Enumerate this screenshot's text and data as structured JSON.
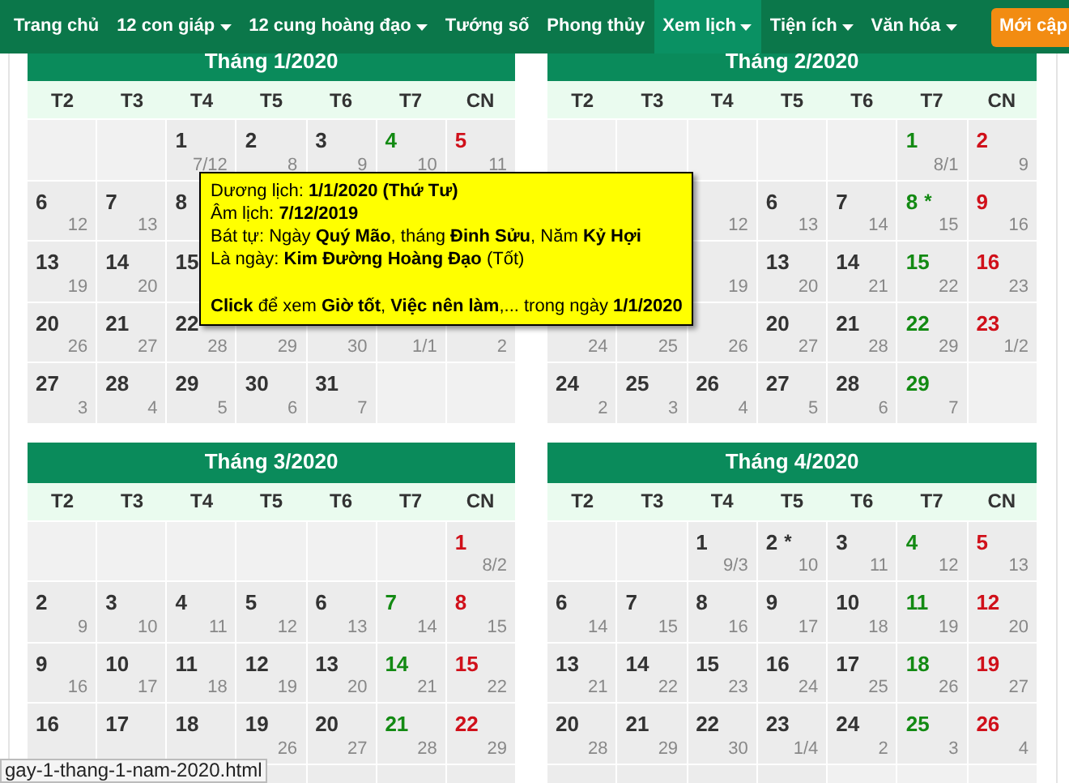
{
  "nav": {
    "items": [
      {
        "label": "Trang chủ",
        "dropdown": false,
        "selected": false
      },
      {
        "label": "12 con giáp",
        "dropdown": true,
        "selected": false
      },
      {
        "label": "12 cung hoàng đạo",
        "dropdown": true,
        "selected": false
      },
      {
        "label": "Tướng số",
        "dropdown": false,
        "selected": false
      },
      {
        "label": "Phong thủy",
        "dropdown": false,
        "selected": false
      },
      {
        "label": "Xem lịch",
        "dropdown": true,
        "selected": true
      },
      {
        "label": "Tiện ích",
        "dropdown": true,
        "selected": false
      },
      {
        "label": "Văn hóa",
        "dropdown": true,
        "selected": false
      }
    ],
    "button": "Mới cập"
  },
  "months": [
    {
      "title": "Tháng 1/2020",
      "weekdays": [
        "T2",
        "T3",
        "T4",
        "T5",
        "T6",
        "T7",
        "CN"
      ],
      "rows": [
        [
          {
            "kind": "empty"
          },
          {
            "kind": "empty"
          },
          {
            "kind": "day",
            "day": "1",
            "lunar": "7/12"
          },
          {
            "kind": "day",
            "day": "2",
            "lunar": "8"
          },
          {
            "kind": "day",
            "day": "3",
            "lunar": "9"
          },
          {
            "kind": "day",
            "day": "4",
            "lunar": "10"
          },
          {
            "kind": "day",
            "day": "5",
            "lunar": "11"
          }
        ],
        [
          {
            "kind": "day",
            "day": "6",
            "lunar": "12"
          },
          {
            "kind": "day",
            "day": "7",
            "lunar": "13"
          },
          {
            "kind": "day",
            "day": "8"
          },
          {
            "kind": "covered"
          },
          {
            "kind": "covered"
          },
          {
            "kind": "covered"
          },
          {
            "kind": "covered"
          }
        ],
        [
          {
            "kind": "day",
            "day": "13",
            "lunar": "19"
          },
          {
            "kind": "day",
            "day": "14",
            "lunar": "20"
          },
          {
            "kind": "day",
            "day": "15"
          },
          {
            "kind": "covered"
          },
          {
            "kind": "covered"
          },
          {
            "kind": "covered"
          },
          {
            "kind": "covered"
          }
        ],
        [
          {
            "kind": "day",
            "day": "20",
            "lunar": "26"
          },
          {
            "kind": "day",
            "day": "21",
            "lunar": "27"
          },
          {
            "kind": "day",
            "day": "22",
            "lunar": "28"
          },
          {
            "kind": "day",
            "lunar": "29"
          },
          {
            "kind": "day",
            "lunar": "30"
          },
          {
            "kind": "day",
            "lunar": "1/1"
          },
          {
            "kind": "day",
            "lunar": "2"
          }
        ],
        [
          {
            "kind": "day",
            "day": "27",
            "lunar": "3"
          },
          {
            "kind": "day",
            "day": "28",
            "lunar": "4"
          },
          {
            "kind": "day",
            "day": "29",
            "lunar": "5"
          },
          {
            "kind": "day",
            "day": "30",
            "lunar": "6"
          },
          {
            "kind": "day",
            "day": "31",
            "lunar": "7"
          },
          {
            "kind": "empty"
          },
          {
            "kind": "empty"
          }
        ]
      ]
    },
    {
      "title": "Tháng 2/2020",
      "weekdays": [
        "T2",
        "T3",
        "T4",
        "T5",
        "T6",
        "T7",
        "CN"
      ],
      "rows": [
        [
          {
            "kind": "empty"
          },
          {
            "kind": "empty"
          },
          {
            "kind": "empty"
          },
          {
            "kind": "empty"
          },
          {
            "kind": "empty"
          },
          {
            "kind": "day",
            "day": "1",
            "lunar": "8/1"
          },
          {
            "kind": "day",
            "day": "2",
            "lunar": "9"
          }
        ],
        [
          {
            "kind": "covered"
          },
          {
            "kind": "covered"
          },
          {
            "kind": "day",
            "lunar": "12"
          },
          {
            "kind": "day",
            "day": "6",
            "lunar": "13"
          },
          {
            "kind": "day",
            "day": "7",
            "lunar": "14"
          },
          {
            "kind": "day",
            "day": "8",
            "mark": "*",
            "lunar": "15"
          },
          {
            "kind": "day",
            "day": "9",
            "lunar": "16"
          }
        ],
        [
          {
            "kind": "covered"
          },
          {
            "kind": "covered"
          },
          {
            "kind": "day",
            "lunar": "19"
          },
          {
            "kind": "day",
            "day": "13",
            "lunar": "20"
          },
          {
            "kind": "day",
            "day": "14",
            "lunar": "21"
          },
          {
            "kind": "day",
            "day": "15",
            "lunar": "22"
          },
          {
            "kind": "day",
            "day": "16",
            "lunar": "23"
          }
        ],
        [
          {
            "kind": "day",
            "lunar": "24"
          },
          {
            "kind": "day",
            "lunar": "25"
          },
          {
            "kind": "day",
            "lunar": "26"
          },
          {
            "kind": "day",
            "day": "20",
            "lunar": "27"
          },
          {
            "kind": "day",
            "day": "21",
            "lunar": "28"
          },
          {
            "kind": "day",
            "day": "22",
            "lunar": "29"
          },
          {
            "kind": "day",
            "day": "23",
            "lunar": "1/2"
          }
        ],
        [
          {
            "kind": "day",
            "day": "24",
            "lunar": "2"
          },
          {
            "kind": "day",
            "day": "25",
            "lunar": "3"
          },
          {
            "kind": "day",
            "day": "26",
            "lunar": "4"
          },
          {
            "kind": "day",
            "day": "27",
            "lunar": "5"
          },
          {
            "kind": "day",
            "day": "28",
            "lunar": "6"
          },
          {
            "kind": "day",
            "day": "29",
            "lunar": "7"
          },
          {
            "kind": "empty"
          }
        ]
      ]
    },
    {
      "title": "Tháng 3/2020",
      "weekdays": [
        "T2",
        "T3",
        "T4",
        "T5",
        "T6",
        "T7",
        "CN"
      ],
      "rows": [
        [
          {
            "kind": "empty"
          },
          {
            "kind": "empty"
          },
          {
            "kind": "empty"
          },
          {
            "kind": "empty"
          },
          {
            "kind": "empty"
          },
          {
            "kind": "empty"
          },
          {
            "kind": "day",
            "day": "1",
            "lunar": "8/2"
          }
        ],
        [
          {
            "kind": "day",
            "day": "2",
            "lunar": "9"
          },
          {
            "kind": "day",
            "day": "3",
            "lunar": "10"
          },
          {
            "kind": "day",
            "day": "4",
            "lunar": "11"
          },
          {
            "kind": "day",
            "day": "5",
            "lunar": "12"
          },
          {
            "kind": "day",
            "day": "6",
            "lunar": "13"
          },
          {
            "kind": "day",
            "day": "7",
            "lunar": "14"
          },
          {
            "kind": "day",
            "day": "8",
            "lunar": "15"
          }
        ],
        [
          {
            "kind": "day",
            "day": "9",
            "lunar": "16"
          },
          {
            "kind": "day",
            "day": "10",
            "lunar": "17"
          },
          {
            "kind": "day",
            "day": "11",
            "lunar": "18"
          },
          {
            "kind": "day",
            "day": "12",
            "lunar": "19"
          },
          {
            "kind": "day",
            "day": "13",
            "lunar": "20"
          },
          {
            "kind": "day",
            "day": "14",
            "lunar": "21"
          },
          {
            "kind": "day",
            "day": "15",
            "lunar": "22"
          }
        ],
        [
          {
            "kind": "day",
            "day": "16"
          },
          {
            "kind": "day",
            "day": "17"
          },
          {
            "kind": "day",
            "day": "18"
          },
          {
            "kind": "day",
            "day": "19",
            "lunar": "26"
          },
          {
            "kind": "day",
            "day": "20",
            "lunar": "27"
          },
          {
            "kind": "day",
            "day": "21",
            "lunar": "28"
          },
          {
            "kind": "day",
            "day": "22",
            "lunar": "29"
          }
        ],
        [
          {
            "kind": "day"
          },
          {
            "kind": "day"
          },
          {
            "kind": "day"
          },
          {
            "kind": "day"
          },
          {
            "kind": "day"
          },
          {
            "kind": "day"
          },
          {
            "kind": "day"
          }
        ]
      ]
    },
    {
      "title": "Tháng 4/2020",
      "weekdays": [
        "T2",
        "T3",
        "T4",
        "T5",
        "T6",
        "T7",
        "CN"
      ],
      "rows": [
        [
          {
            "kind": "empty"
          },
          {
            "kind": "empty"
          },
          {
            "kind": "day",
            "day": "1",
            "lunar": "9/3"
          },
          {
            "kind": "day",
            "day": "2",
            "mark": "*",
            "lunar": "10"
          },
          {
            "kind": "day",
            "day": "3",
            "lunar": "11"
          },
          {
            "kind": "day",
            "day": "4",
            "lunar": "12"
          },
          {
            "kind": "day",
            "day": "5",
            "lunar": "13"
          }
        ],
        [
          {
            "kind": "day",
            "day": "6",
            "lunar": "14"
          },
          {
            "kind": "day",
            "day": "7",
            "lunar": "15"
          },
          {
            "kind": "day",
            "day": "8",
            "lunar": "16"
          },
          {
            "kind": "day",
            "day": "9",
            "lunar": "17"
          },
          {
            "kind": "day",
            "day": "10",
            "lunar": "18"
          },
          {
            "kind": "day",
            "day": "11",
            "lunar": "19"
          },
          {
            "kind": "day",
            "day": "12",
            "lunar": "20"
          }
        ],
        [
          {
            "kind": "day",
            "day": "13",
            "lunar": "21"
          },
          {
            "kind": "day",
            "day": "14",
            "lunar": "22"
          },
          {
            "kind": "day",
            "day": "15",
            "lunar": "23"
          },
          {
            "kind": "day",
            "day": "16",
            "lunar": "24"
          },
          {
            "kind": "day",
            "day": "17",
            "lunar": "25"
          },
          {
            "kind": "day",
            "day": "18",
            "lunar": "26"
          },
          {
            "kind": "day",
            "day": "19",
            "lunar": "27"
          }
        ],
        [
          {
            "kind": "day",
            "day": "20",
            "lunar": "28"
          },
          {
            "kind": "day",
            "day": "21",
            "lunar": "29"
          },
          {
            "kind": "day",
            "day": "22",
            "lunar": "30"
          },
          {
            "kind": "day",
            "day": "23",
            "lunar": "1/4"
          },
          {
            "kind": "day",
            "day": "24",
            "lunar": "2"
          },
          {
            "kind": "day",
            "day": "25",
            "lunar": "3"
          },
          {
            "kind": "day",
            "day": "26",
            "lunar": "4"
          }
        ],
        [
          {
            "kind": "day"
          },
          {
            "kind": "day"
          },
          {
            "kind": "day"
          },
          {
            "kind": "day"
          },
          {
            "kind": "empty"
          },
          {
            "kind": "empty"
          },
          {
            "kind": "empty"
          }
        ]
      ]
    }
  ],
  "tooltip": {
    "lines": [
      "Dương lịch: **1/1/2020 (Thứ Tư)**",
      "Âm lịch: **7/12/2019**",
      "Bát tự: Ngày **Quý Mão**, tháng **Đinh Sửu**, Năm **Kỷ Hợi**",
      "Là ngày: **Kim Đường Hoàng Đạo** (Tốt)",
      "**Click** để xem **Giờ tốt**, **Việc nên làm**,... trong ngày **1/1/2020**"
    ]
  },
  "status_url": "gay-1-thang-1-nam-2020.html"
}
